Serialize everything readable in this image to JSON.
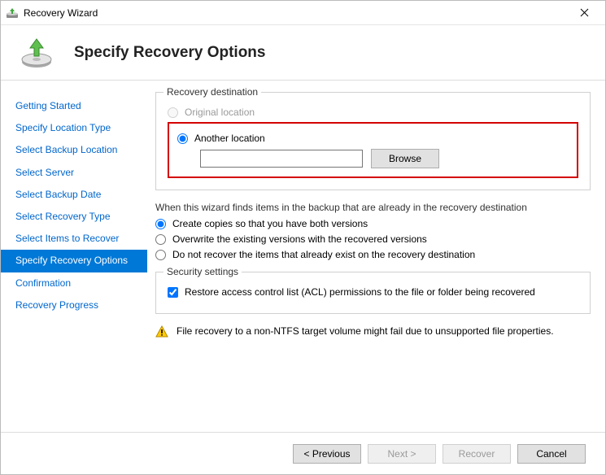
{
  "titlebar": {
    "title": "Recovery Wizard"
  },
  "header": {
    "heading": "Specify Recovery Options"
  },
  "sidebar": {
    "items": [
      {
        "label": "Getting Started"
      },
      {
        "label": "Specify Location Type"
      },
      {
        "label": "Select Backup Location"
      },
      {
        "label": "Select Server"
      },
      {
        "label": "Select Backup Date"
      },
      {
        "label": "Select Recovery Type"
      },
      {
        "label": "Select Items to Recover"
      },
      {
        "label": "Specify Recovery Options"
      },
      {
        "label": "Confirmation"
      },
      {
        "label": "Recovery Progress"
      }
    ],
    "active_index": 7
  },
  "content": {
    "destination": {
      "legend": "Recovery destination",
      "original": "Original location",
      "another": "Another location",
      "path_value": "",
      "browse": "Browse"
    },
    "conflict": {
      "intro": "When this wizard finds items in the backup that are already in the recovery destination",
      "opt1": "Create copies so that you have both versions",
      "opt2": "Overwrite the existing versions with the recovered versions",
      "opt3": "Do not recover the items that already exist on the recovery destination"
    },
    "security": {
      "legend": "Security settings",
      "acl": "Restore access control list (ACL) permissions to the file or folder being recovered"
    },
    "warning": "File recovery to a non-NTFS target volume might fail due to unsupported file properties."
  },
  "footer": {
    "previous": "< Previous",
    "next": "Next >",
    "recover": "Recover",
    "cancel": "Cancel"
  }
}
